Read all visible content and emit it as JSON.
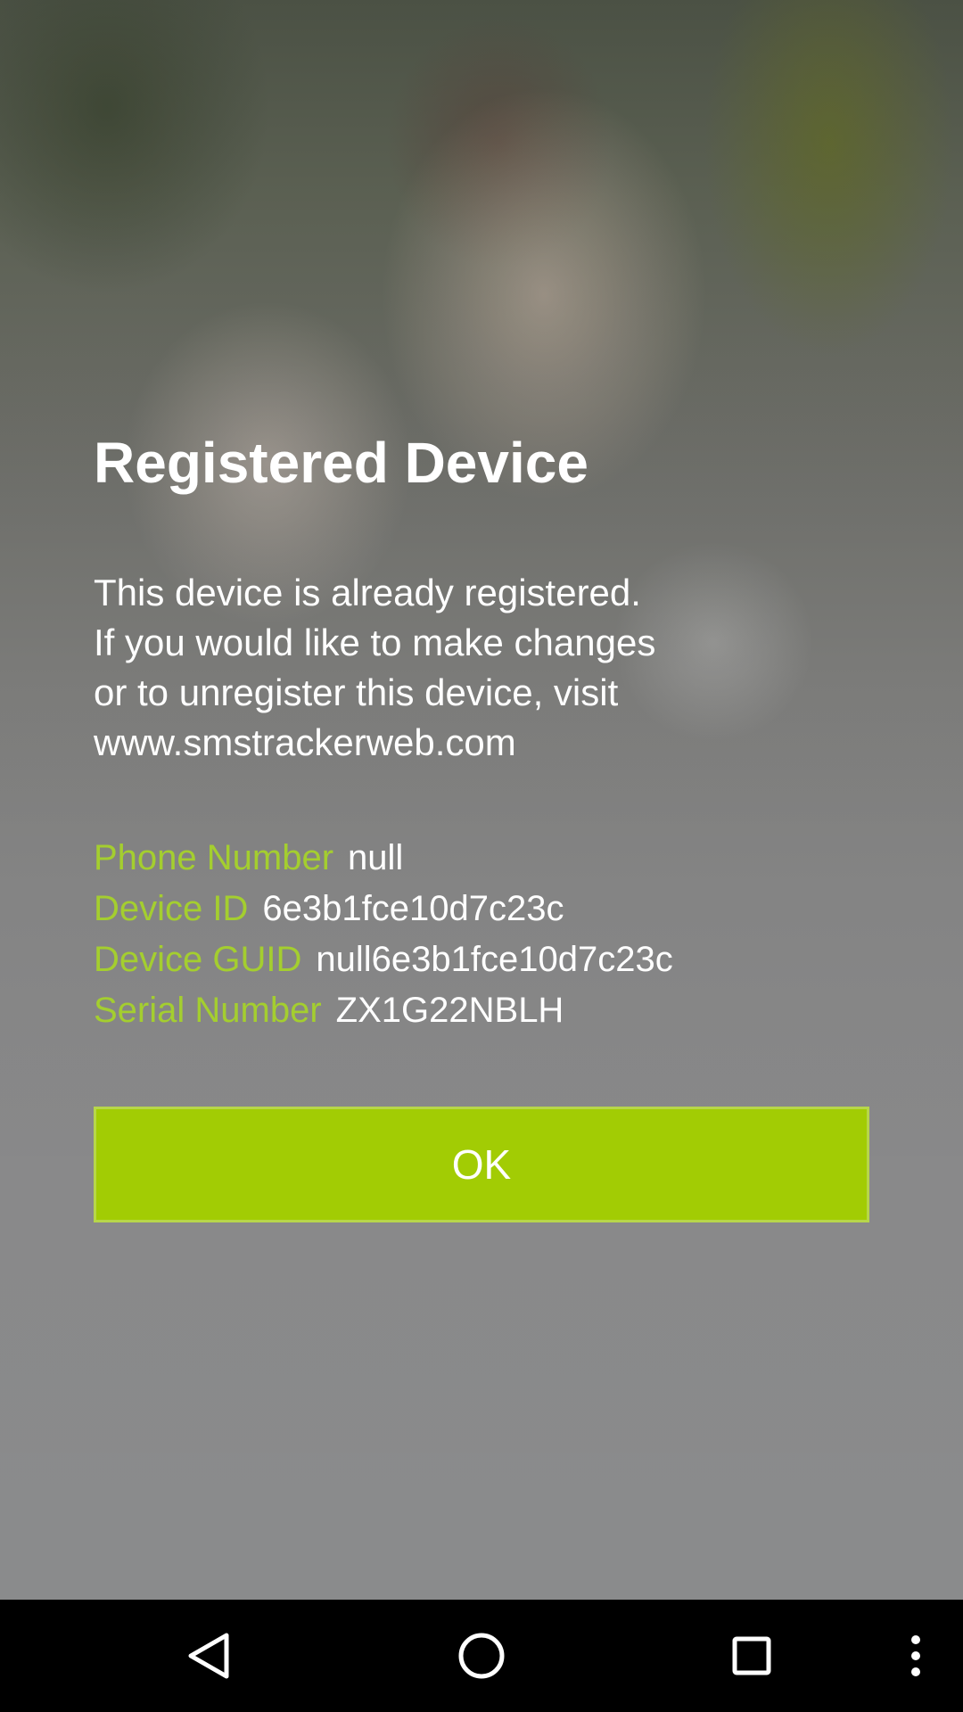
{
  "dialog": {
    "title": "Registered Device",
    "message_lines": [
      "This device is already registered.",
      "If you would like to make changes",
      "or to unregister this device, visit",
      "www.smstrackerweb.com"
    ],
    "info": [
      {
        "label": "Phone Number",
        "value": "null"
      },
      {
        "label": "Device ID",
        "value": "6e3b1fce10d7c23c"
      },
      {
        "label": "Device GUID",
        "value": "null6e3b1fce10d7c23c"
      },
      {
        "label": "Serial Number",
        "value": "ZX1G22NBLH"
      }
    ],
    "ok_label": "OK"
  },
  "colors": {
    "accent": "#a2cc04",
    "label": "#a4ce2f",
    "text": "#ffffff",
    "nav_bar": "#000000"
  },
  "nav_bar": {
    "icons": [
      "back-icon",
      "home-icon",
      "recents-icon",
      "more-vert-icon"
    ]
  }
}
